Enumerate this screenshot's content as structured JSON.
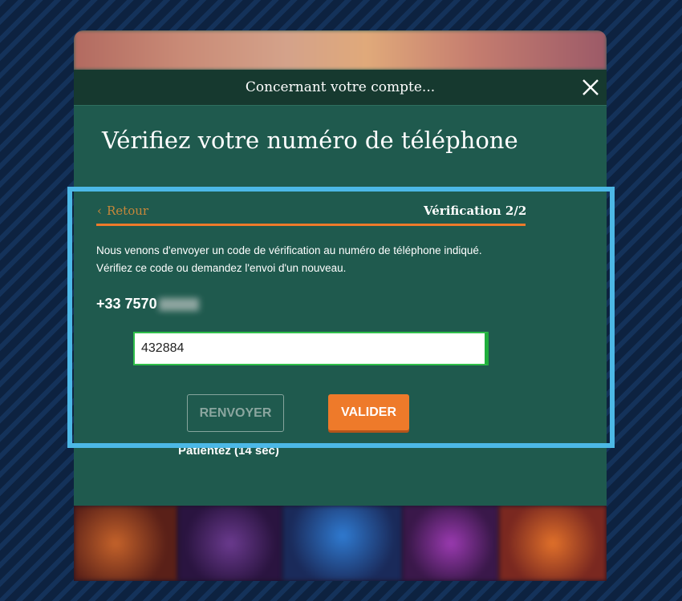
{
  "modal": {
    "header_title": "Concernant votre compte...",
    "page_title": "Vérifiez votre numéro de téléphone"
  },
  "verification": {
    "back_label": "Retour",
    "step_label": "Vérification 2/2",
    "description_line1": "Nous venons d'envoyer un code de vérification au numéro de téléphone indiqué.",
    "description_line2": "Vérifiez ce code ou demandez l'envoi d'un nouveau.",
    "phone_visible": "+33 7570",
    "code_value": "432884",
    "resend_label": "RENVOYER",
    "validate_label": "VALIDER",
    "wait_text": "Patientez (14 sec)"
  },
  "colors": {
    "modal_bg": "#1f5a4e",
    "accent_orange": "#ee7a2a",
    "highlight_blue": "#4cb8e6",
    "input_border_green": "#2fbf4a"
  },
  "icons": [
    "close-icon",
    "chevron-left-icon"
  ]
}
